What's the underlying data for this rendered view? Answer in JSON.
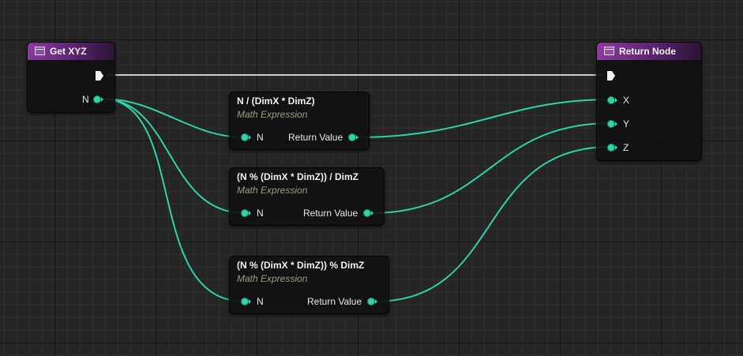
{
  "nodes": {
    "get_xyz": {
      "title": "Get XYZ",
      "output_n": "N"
    },
    "return_node": {
      "title": "Return Node",
      "inputs": [
        "X",
        "Y",
        "Z"
      ]
    },
    "expr1": {
      "title": "N / (DimX * DimZ)",
      "subtitle": "Math Expression",
      "input": "N",
      "output": "Return Value"
    },
    "expr2": {
      "title": "(N % (DimX * DimZ)) / DimZ",
      "subtitle": "Math Expression",
      "input": "N",
      "output": "Return Value"
    },
    "expr3": {
      "title": "(N % (DimX * DimZ)) % DimZ",
      "subtitle": "Math Expression",
      "input": "N",
      "output": "Return Value"
    }
  },
  "colors": {
    "function_header": "#8c3a9e",
    "integer_pin": "#2fd3a6",
    "exec_wire": "#cfcfcf",
    "subtitle": "#9c9c86"
  },
  "icons": [
    "function-icon",
    "exec-pin-icon"
  ]
}
